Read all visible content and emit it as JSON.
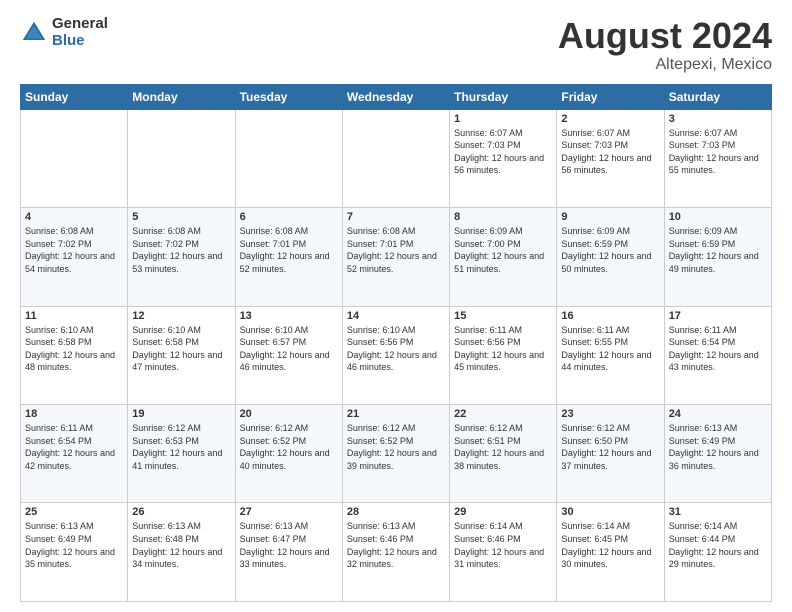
{
  "logo": {
    "general": "General",
    "blue": "Blue"
  },
  "header": {
    "month": "August 2024",
    "location": "Altepexi, Mexico"
  },
  "weekdays": [
    "Sunday",
    "Monday",
    "Tuesday",
    "Wednesday",
    "Thursday",
    "Friday",
    "Saturday"
  ],
  "weeks": [
    [
      {
        "day": "",
        "info": ""
      },
      {
        "day": "",
        "info": ""
      },
      {
        "day": "",
        "info": ""
      },
      {
        "day": "",
        "info": ""
      },
      {
        "day": "1",
        "info": "Sunrise: 6:07 AM\nSunset: 7:03 PM\nDaylight: 12 hours and 56 minutes."
      },
      {
        "day": "2",
        "info": "Sunrise: 6:07 AM\nSunset: 7:03 PM\nDaylight: 12 hours and 56 minutes."
      },
      {
        "day": "3",
        "info": "Sunrise: 6:07 AM\nSunset: 7:03 PM\nDaylight: 12 hours and 55 minutes."
      }
    ],
    [
      {
        "day": "4",
        "info": "Sunrise: 6:08 AM\nSunset: 7:02 PM\nDaylight: 12 hours and 54 minutes."
      },
      {
        "day": "5",
        "info": "Sunrise: 6:08 AM\nSunset: 7:02 PM\nDaylight: 12 hours and 53 minutes."
      },
      {
        "day": "6",
        "info": "Sunrise: 6:08 AM\nSunset: 7:01 PM\nDaylight: 12 hours and 52 minutes."
      },
      {
        "day": "7",
        "info": "Sunrise: 6:08 AM\nSunset: 7:01 PM\nDaylight: 12 hours and 52 minutes."
      },
      {
        "day": "8",
        "info": "Sunrise: 6:09 AM\nSunset: 7:00 PM\nDaylight: 12 hours and 51 minutes."
      },
      {
        "day": "9",
        "info": "Sunrise: 6:09 AM\nSunset: 6:59 PM\nDaylight: 12 hours and 50 minutes."
      },
      {
        "day": "10",
        "info": "Sunrise: 6:09 AM\nSunset: 6:59 PM\nDaylight: 12 hours and 49 minutes."
      }
    ],
    [
      {
        "day": "11",
        "info": "Sunrise: 6:10 AM\nSunset: 6:58 PM\nDaylight: 12 hours and 48 minutes."
      },
      {
        "day": "12",
        "info": "Sunrise: 6:10 AM\nSunset: 6:58 PM\nDaylight: 12 hours and 47 minutes."
      },
      {
        "day": "13",
        "info": "Sunrise: 6:10 AM\nSunset: 6:57 PM\nDaylight: 12 hours and 46 minutes."
      },
      {
        "day": "14",
        "info": "Sunrise: 6:10 AM\nSunset: 6:56 PM\nDaylight: 12 hours and 46 minutes."
      },
      {
        "day": "15",
        "info": "Sunrise: 6:11 AM\nSunset: 6:56 PM\nDaylight: 12 hours and 45 minutes."
      },
      {
        "day": "16",
        "info": "Sunrise: 6:11 AM\nSunset: 6:55 PM\nDaylight: 12 hours and 44 minutes."
      },
      {
        "day": "17",
        "info": "Sunrise: 6:11 AM\nSunset: 6:54 PM\nDaylight: 12 hours and 43 minutes."
      }
    ],
    [
      {
        "day": "18",
        "info": "Sunrise: 6:11 AM\nSunset: 6:54 PM\nDaylight: 12 hours and 42 minutes."
      },
      {
        "day": "19",
        "info": "Sunrise: 6:12 AM\nSunset: 6:53 PM\nDaylight: 12 hours and 41 minutes."
      },
      {
        "day": "20",
        "info": "Sunrise: 6:12 AM\nSunset: 6:52 PM\nDaylight: 12 hours and 40 minutes."
      },
      {
        "day": "21",
        "info": "Sunrise: 6:12 AM\nSunset: 6:52 PM\nDaylight: 12 hours and 39 minutes."
      },
      {
        "day": "22",
        "info": "Sunrise: 6:12 AM\nSunset: 6:51 PM\nDaylight: 12 hours and 38 minutes."
      },
      {
        "day": "23",
        "info": "Sunrise: 6:12 AM\nSunset: 6:50 PM\nDaylight: 12 hours and 37 minutes."
      },
      {
        "day": "24",
        "info": "Sunrise: 6:13 AM\nSunset: 6:49 PM\nDaylight: 12 hours and 36 minutes."
      }
    ],
    [
      {
        "day": "25",
        "info": "Sunrise: 6:13 AM\nSunset: 6:49 PM\nDaylight: 12 hours and 35 minutes."
      },
      {
        "day": "26",
        "info": "Sunrise: 6:13 AM\nSunset: 6:48 PM\nDaylight: 12 hours and 34 minutes."
      },
      {
        "day": "27",
        "info": "Sunrise: 6:13 AM\nSunset: 6:47 PM\nDaylight: 12 hours and 33 minutes."
      },
      {
        "day": "28",
        "info": "Sunrise: 6:13 AM\nSunset: 6:46 PM\nDaylight: 12 hours and 32 minutes."
      },
      {
        "day": "29",
        "info": "Sunrise: 6:14 AM\nSunset: 6:46 PM\nDaylight: 12 hours and 31 minutes."
      },
      {
        "day": "30",
        "info": "Sunrise: 6:14 AM\nSunset: 6:45 PM\nDaylight: 12 hours and 30 minutes."
      },
      {
        "day": "31",
        "info": "Sunrise: 6:14 AM\nSunset: 6:44 PM\nDaylight: 12 hours and 29 minutes."
      }
    ]
  ]
}
